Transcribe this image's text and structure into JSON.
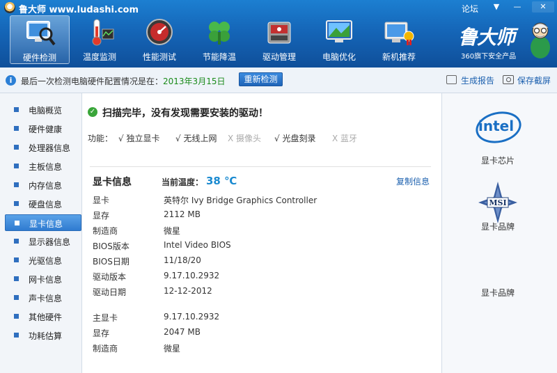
{
  "app": {
    "title": "鲁大师 www.ludashi.com",
    "forum": "论坛",
    "window_controls": {
      "dropdown": "▼",
      "minimize": "—",
      "close": "✕"
    }
  },
  "toolbar": {
    "items": [
      {
        "label": "硬件检测",
        "icon": "monitor-magnifier-icon",
        "active": true
      },
      {
        "label": "温度监测",
        "icon": "thermometer-icon",
        "active": false
      },
      {
        "label": "性能测试",
        "icon": "speedometer-icon",
        "active": false
      },
      {
        "label": "节能降温",
        "icon": "clover-icon",
        "active": false
      },
      {
        "label": "驱动管理",
        "icon": "driver-box-icon",
        "active": false
      },
      {
        "label": "电脑优化",
        "icon": "optimize-monitor-icon",
        "active": false
      },
      {
        "label": "新机推荐",
        "icon": "new-pc-icon",
        "active": false
      }
    ]
  },
  "brand": {
    "name": "鲁大师",
    "slogan": "360旗下安全产品"
  },
  "status": {
    "prefix": "最后一次检测电脑硬件配置情况是在：",
    "date": "2013年3月15日",
    "rescan": "重新检测",
    "report": "生成报告",
    "screenshot": "保存截屏"
  },
  "sidebar": {
    "items": [
      {
        "label": "电脑概览",
        "active": false
      },
      {
        "label": "硬件健康",
        "active": false
      },
      {
        "label": "处理器信息",
        "active": false
      },
      {
        "label": "主板信息",
        "active": false
      },
      {
        "label": "内存信息",
        "active": false
      },
      {
        "label": "硬盘信息",
        "active": false
      },
      {
        "label": "显卡信息",
        "active": true
      },
      {
        "label": "显示器信息",
        "active": false
      },
      {
        "label": "光驱信息",
        "active": false
      },
      {
        "label": "网卡信息",
        "active": false
      },
      {
        "label": "声卡信息",
        "active": false
      },
      {
        "label": "其他硬件",
        "active": false
      },
      {
        "label": "功耗估算",
        "active": false
      }
    ]
  },
  "main": {
    "scan_result": "扫描完毕，没有发现需要安装的驱动！",
    "features_label": "功能：",
    "features": [
      {
        "label": "√ 独立显卡",
        "enabled": true
      },
      {
        "label": "√ 无线上网",
        "enabled": true
      },
      {
        "label": "X 摄像头",
        "enabled": false
      },
      {
        "label": "√ 光盘刻录",
        "enabled": true
      },
      {
        "label": "X 蓝牙",
        "enabled": false
      }
    ],
    "section_title": "显卡信息",
    "temp_label": "当前温度：",
    "temp_value": "38 ℃",
    "copy": "复制信息",
    "rows": [
      {
        "key": "显卡",
        "value": "英特尔 Ivy Bridge Graphics Controller"
      },
      {
        "key": "显存",
        "value": "2112 MB"
      },
      {
        "key": "制造商",
        "value": "微星"
      },
      {
        "key": "BIOS版本",
        "value": "Intel Video BIOS"
      },
      {
        "key": "BIOS日期",
        "value": "11/18/20"
      },
      {
        "key": "驱动版本",
        "value": "9.17.10.2932"
      },
      {
        "key": "驱动日期",
        "value": "12-12-2012"
      },
      {
        "key": "主显卡",
        "value": "9.17.10.2932"
      },
      {
        "key": "显存",
        "value": "2047 MB"
      },
      {
        "key": "制造商",
        "value": "微星"
      }
    ]
  },
  "right_panel": {
    "chip_logo_text": "intel",
    "chip_label": "显卡芯片",
    "vendor_logo_text": "MSI",
    "vendor_label_1": "显卡品牌",
    "vendor_label_2": "显卡品牌"
  },
  "colors": {
    "header_blue": "#1566b8",
    "accent_green": "#1a8a1a",
    "temp_blue": "#1a8ad0",
    "link_blue": "#1a5fae"
  }
}
